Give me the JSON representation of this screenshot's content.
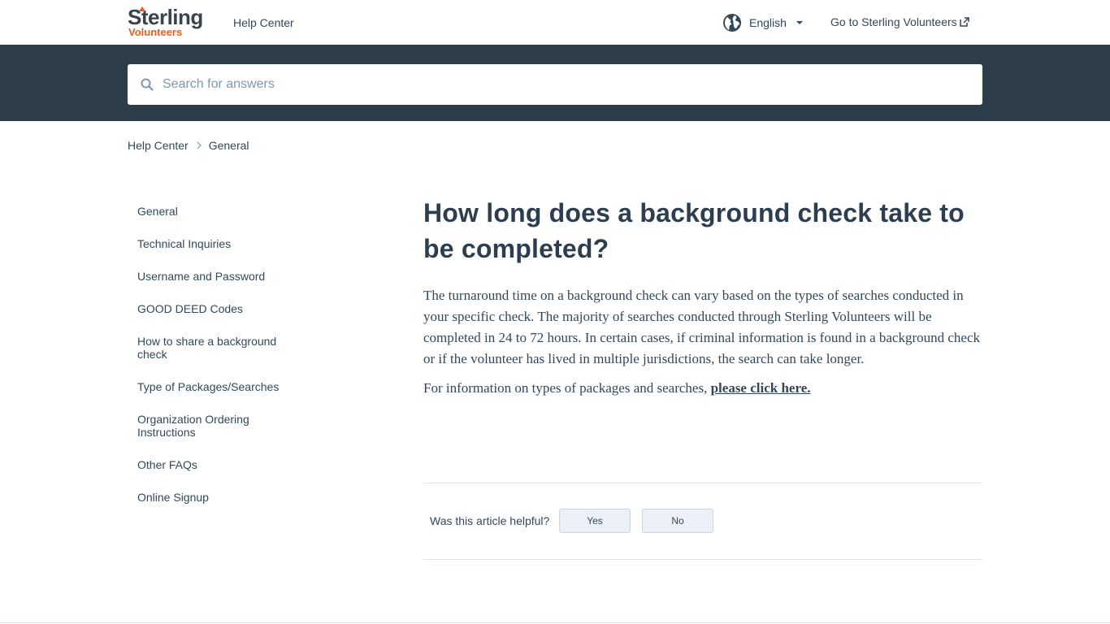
{
  "header": {
    "logo_main": "Sterling",
    "logo_sub": "Volunteers",
    "help_center_label": "Help Center",
    "language_label": "English",
    "external_link_label": "Go to Sterling Volunteers"
  },
  "search": {
    "placeholder": "Search for answers",
    "value": ""
  },
  "breadcrumb": {
    "items": [
      "Help Center",
      "General"
    ]
  },
  "sidebar": {
    "items": [
      {
        "label": "General"
      },
      {
        "label": "Technical Inquiries"
      },
      {
        "label": "Username and Password"
      },
      {
        "label": "GOOD DEED Codes"
      },
      {
        "label": "How to share a background check"
      },
      {
        "label": "Type of Packages/Searches"
      },
      {
        "label": "Organization Ordering Instructions"
      },
      {
        "label": "Other FAQs"
      },
      {
        "label": "Online Signup"
      }
    ]
  },
  "article": {
    "title": "How long does a background check take to be completed?",
    "paragraph1": "The turnaround time on a background check can vary based on the types of searches conducted in your specific check. The majority of searches conducted through Sterling Volunteers will be completed in 24 to 72 hours. In certain cases, if criminal information is found in a background check or if the volunteer has lived in multiple jurisdictions, the search can take longer.",
    "paragraph2_text": "For information on types of packages and searches, ",
    "paragraph2_link": "please click here."
  },
  "feedback": {
    "question": "Was this article helpful?",
    "yes_label": "Yes",
    "no_label": "No"
  },
  "colors": {
    "brand_orange": "#e8601c",
    "search_band": "#2d3e4a",
    "text": "#33475b"
  },
  "icons": [
    "search-icon",
    "globe-icon",
    "chevron-down-icon",
    "external-link-icon",
    "chevron-right-icon"
  ]
}
